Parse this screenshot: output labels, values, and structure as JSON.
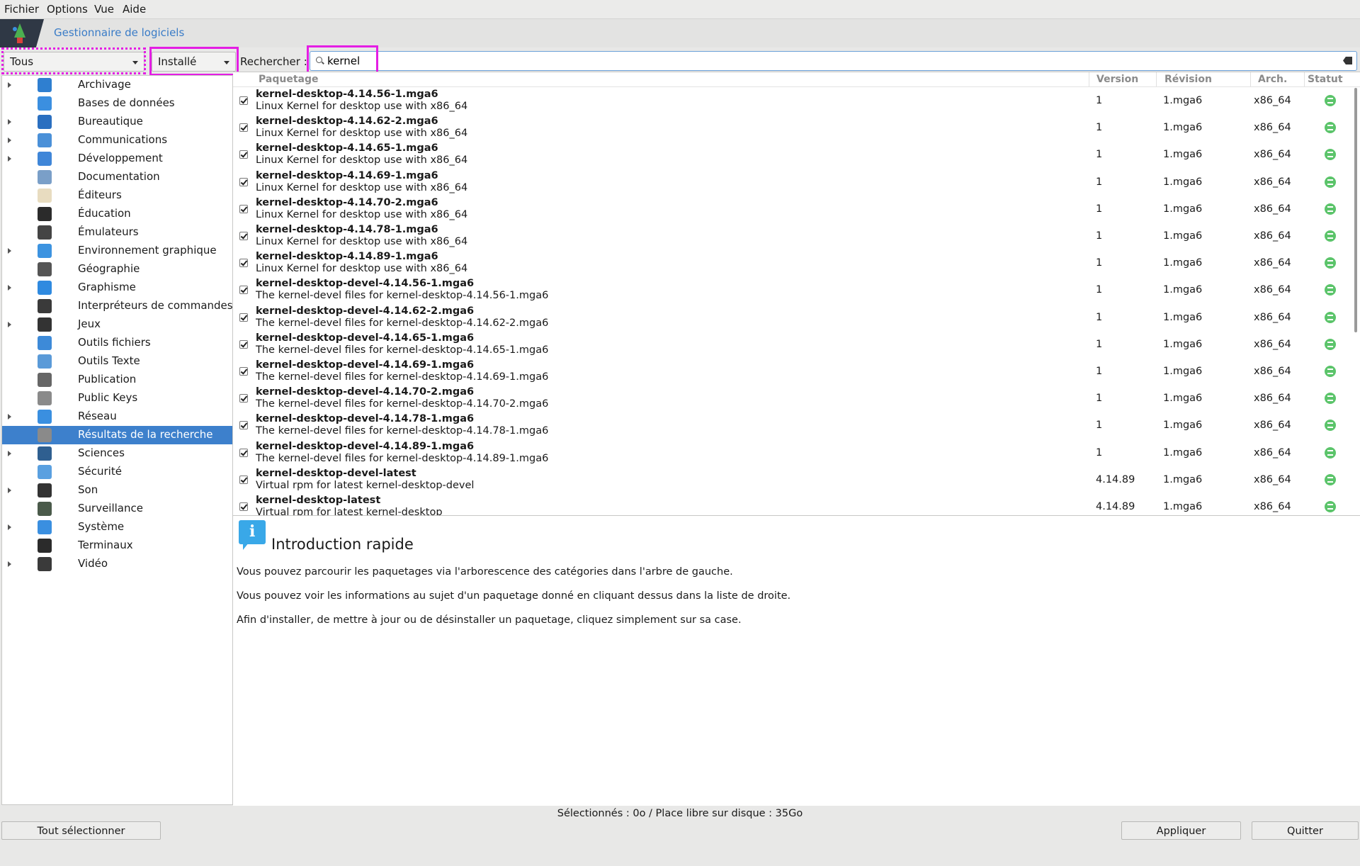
{
  "menubar": {
    "items": [
      "Fichier",
      "Options",
      "Vue",
      "Aide"
    ]
  },
  "header": {
    "title": "Gestionnaire de logiciels"
  },
  "filters": {
    "group": "Tous",
    "status": "Installé"
  },
  "search": {
    "label": "Rechercher :",
    "value": "kernel"
  },
  "categories": [
    {
      "label": "Archivage",
      "expandable": true,
      "icon": "archive-icon",
      "color": "#2f7fd0"
    },
    {
      "label": "Bases de données",
      "expandable": false,
      "icon": "database-icon",
      "color": "#3b8fe0"
    },
    {
      "label": "Bureautique",
      "expandable": true,
      "icon": "office-icon",
      "color": "#2a6fc0"
    },
    {
      "label": "Communications",
      "expandable": true,
      "icon": "chat-icon",
      "color": "#4a90d8"
    },
    {
      "label": "Développement",
      "expandable": true,
      "icon": "development-icon",
      "color": "#3f86d8"
    },
    {
      "label": "Documentation",
      "expandable": false,
      "icon": "documentation-icon",
      "color": "#7a9fc8"
    },
    {
      "label": "Éditeurs",
      "expandable": false,
      "icon": "editor-icon",
      "color": "#e8dcc0"
    },
    {
      "label": "Éducation",
      "expandable": false,
      "icon": "education-icon",
      "color": "#2b2b2b"
    },
    {
      "label": "Émulateurs",
      "expandable": false,
      "icon": "gamepad-icon",
      "color": "#444444"
    },
    {
      "label": "Environnement graphique",
      "expandable": true,
      "icon": "desktop-environment-icon",
      "color": "#3c93e0"
    },
    {
      "label": "Géographie",
      "expandable": false,
      "icon": "globe-icon",
      "color": "#555555"
    },
    {
      "label": "Graphisme",
      "expandable": true,
      "icon": "graphics-icon",
      "color": "#2f8ae0"
    },
    {
      "label": "Interpréteurs de commandes",
      "expandable": false,
      "icon": "shell-icon",
      "color": "#3a3a3a"
    },
    {
      "label": "Jeux",
      "expandable": true,
      "icon": "games-icon",
      "color": "#333333"
    },
    {
      "label": "Outils fichiers",
      "expandable": false,
      "icon": "file-tools-icon",
      "color": "#3d8ad8"
    },
    {
      "label": "Outils Texte",
      "expandable": false,
      "icon": "text-tools-icon",
      "color": "#5a9ad8"
    },
    {
      "label": "Publication",
      "expandable": false,
      "icon": "printer-icon",
      "color": "#666666"
    },
    {
      "label": "Public Keys",
      "expandable": false,
      "icon": "keys-icon",
      "color": "#8a8a8a"
    },
    {
      "label": "Réseau",
      "expandable": true,
      "icon": "network-icon",
      "color": "#3a8fe0"
    },
    {
      "label": "Résultats de la recherche",
      "expandable": false,
      "icon": "search-results-icon",
      "color": "#8a8a8a",
      "selected": true
    },
    {
      "label": "Sciences",
      "expandable": true,
      "icon": "science-icon",
      "color": "#2f5f90"
    },
    {
      "label": "Sécurité",
      "expandable": false,
      "icon": "security-icon",
      "color": "#5aa0e0"
    },
    {
      "label": "Son",
      "expandable": true,
      "icon": "headphones-icon",
      "color": "#333333"
    },
    {
      "label": "Surveillance",
      "expandable": false,
      "icon": "monitoring-icon",
      "color": "#4a5a4a"
    },
    {
      "label": "Système",
      "expandable": true,
      "icon": "system-icon",
      "color": "#3a8fe0"
    },
    {
      "label": "Terminaux",
      "expandable": false,
      "icon": "terminal-icon",
      "color": "#2b2b2b"
    },
    {
      "label": "Vidéo",
      "expandable": true,
      "icon": "video-icon",
      "color": "#3a3a3a"
    }
  ],
  "list": {
    "columns": [
      "Paquetage",
      "Version",
      "Révision",
      "Arch.",
      "Statut"
    ],
    "rows": [
      {
        "name": "kernel-desktop-4.14.56-1.mga6",
        "desc": "Linux Kernel for desktop use with x86_64",
        "version": "1",
        "revision": "1.mga6",
        "arch": "x86_64"
      },
      {
        "name": "kernel-desktop-4.14.62-2.mga6",
        "desc": "Linux Kernel for desktop use with x86_64",
        "version": "1",
        "revision": "1.mga6",
        "arch": "x86_64"
      },
      {
        "name": "kernel-desktop-4.14.65-1.mga6",
        "desc": "Linux Kernel for desktop use with x86_64",
        "version": "1",
        "revision": "1.mga6",
        "arch": "x86_64"
      },
      {
        "name": "kernel-desktop-4.14.69-1.mga6",
        "desc": "Linux Kernel for desktop use with x86_64",
        "version": "1",
        "revision": "1.mga6",
        "arch": "x86_64"
      },
      {
        "name": "kernel-desktop-4.14.70-2.mga6",
        "desc": "Linux Kernel for desktop use with x86_64",
        "version": "1",
        "revision": "1.mga6",
        "arch": "x86_64"
      },
      {
        "name": "kernel-desktop-4.14.78-1.mga6",
        "desc": "Linux Kernel for desktop use with x86_64",
        "version": "1",
        "revision": "1.mga6",
        "arch": "x86_64"
      },
      {
        "name": "kernel-desktop-4.14.89-1.mga6",
        "desc": "Linux Kernel for desktop use with x86_64",
        "version": "1",
        "revision": "1.mga6",
        "arch": "x86_64"
      },
      {
        "name": "kernel-desktop-devel-4.14.56-1.mga6",
        "desc": "The kernel-devel files for kernel-desktop-4.14.56-1.mga6",
        "version": "1",
        "revision": "1.mga6",
        "arch": "x86_64"
      },
      {
        "name": "kernel-desktop-devel-4.14.62-2.mga6",
        "desc": "The kernel-devel files for kernel-desktop-4.14.62-2.mga6",
        "version": "1",
        "revision": "1.mga6",
        "arch": "x86_64"
      },
      {
        "name": "kernel-desktop-devel-4.14.65-1.mga6",
        "desc": "The kernel-devel files for kernel-desktop-4.14.65-1.mga6",
        "version": "1",
        "revision": "1.mga6",
        "arch": "x86_64"
      },
      {
        "name": "kernel-desktop-devel-4.14.69-1.mga6",
        "desc": "The kernel-devel files for kernel-desktop-4.14.69-1.mga6",
        "version": "1",
        "revision": "1.mga6",
        "arch": "x86_64"
      },
      {
        "name": "kernel-desktop-devel-4.14.70-2.mga6",
        "desc": "The kernel-devel files for kernel-desktop-4.14.70-2.mga6",
        "version": "1",
        "revision": "1.mga6",
        "arch": "x86_64"
      },
      {
        "name": "kernel-desktop-devel-4.14.78-1.mga6",
        "desc": "The kernel-devel files for kernel-desktop-4.14.78-1.mga6",
        "version": "1",
        "revision": "1.mga6",
        "arch": "x86_64"
      },
      {
        "name": "kernel-desktop-devel-4.14.89-1.mga6",
        "desc": "The kernel-devel files for kernel-desktop-4.14.89-1.mga6",
        "version": "1",
        "revision": "1.mga6",
        "arch": "x86_64"
      },
      {
        "name": "kernel-desktop-devel-latest",
        "desc": "Virtual rpm for latest kernel-desktop-devel",
        "version": "4.14.89",
        "revision": "1.mga6",
        "arch": "x86_64"
      },
      {
        "name": "kernel-desktop-latest",
        "desc": "Virtual rpm for latest kernel-desktop",
        "version": "4.14.89",
        "revision": "1.mga6",
        "arch": "x86_64"
      }
    ]
  },
  "info": {
    "title": "Introduction rapide",
    "paragraphs": [
      "Vous pouvez parcourir les paquetages via l'arborescence des catégories dans l'arbre de gauche.",
      "Vous pouvez voir les informations au sujet d'un paquetage donné en cliquant dessus dans la liste de droite.",
      "Afin d'installer, de mettre à jour ou de désinstaller un paquetage, cliquez simplement sur sa case."
    ]
  },
  "status": {
    "text": "Sélectionnés : 0o / Place libre sur disque : 35Go"
  },
  "buttons": {
    "select_all": "Tout sélectionner",
    "apply": "Appliquer",
    "quit": "Quitter"
  },
  "colors": {
    "accent": "#3d80cc",
    "highlight": "#e41ee4",
    "installed": "#5bc46a"
  }
}
